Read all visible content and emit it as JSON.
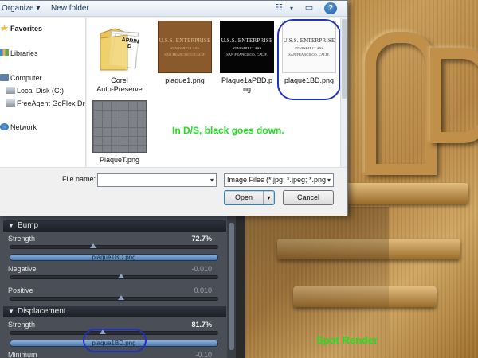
{
  "toolbar": {
    "organize_label": "Organize",
    "new_folder_label": "New folder",
    "help_glyph": "?"
  },
  "nav": {
    "favorites": "Favorites",
    "libraries": "Libraries",
    "computer": "Computer",
    "local_disk": "Local Disk (C:)",
    "goflex": "FreeAgent GoFlex Dr",
    "network": "Network"
  },
  "files": [
    {
      "name": "Corel\nAuto-Preserve",
      "kind": "folder",
      "folder_text": "APRIN\nD"
    },
    {
      "name": "plaque1.png",
      "kind": "plaque-brown",
      "line1": "U.S.S. ENTERPRISE",
      "line2": "STARSHIP   CLASS",
      "line3": "SAN FRANCISCO, CALIF."
    },
    {
      "name": "Plaque1aPBD.png",
      "kind": "plaque-black",
      "line1": "U.S.S. ENTERPRISE",
      "line2": "STARSHIP   CLASS",
      "line3": "SAN FRANCISCO, CALIF."
    },
    {
      "name": "plaque1BD.png",
      "kind": "plaque-white",
      "line1": "U.S.S. ENTERPRISE",
      "line2": "STARSHIP   CLASS",
      "line3": "SAN FRANCISCO, CALIF."
    },
    {
      "name": "PlaqueT.png",
      "kind": "grid"
    }
  ],
  "annotation": "In D/S, black goes down.",
  "file_name": {
    "label": "File name:",
    "value": ""
  },
  "file_type": "Image Files (*.jpg; *.jpeg; *.png;",
  "buttons": {
    "open": "Open",
    "cancel": "Cancel"
  },
  "surface": {
    "bump": {
      "header": "Bump",
      "strength_label": "Strength",
      "strength_value": "72.7%",
      "strength_fraction": 0.385,
      "map": "plaque1BD.png",
      "negative_label": "Negative",
      "negative_value": "-0.010",
      "negative_fraction": 0.52,
      "positive_label": "Positive",
      "positive_value": "0.010",
      "positive_fraction": 0.52
    },
    "displacement": {
      "header": "Displacement",
      "strength_label": "Strength",
      "strength_value": "81.7%",
      "strength_fraction": 0.43,
      "map": "plaque1BD.png",
      "minimum_label": "Minimum",
      "minimum_value": "-0.10"
    }
  },
  "render_label": "Spot Render",
  "colors": {
    "annotation_green": "#22dd22",
    "circle_blue": "#2233bb",
    "wood": "#b58441"
  }
}
